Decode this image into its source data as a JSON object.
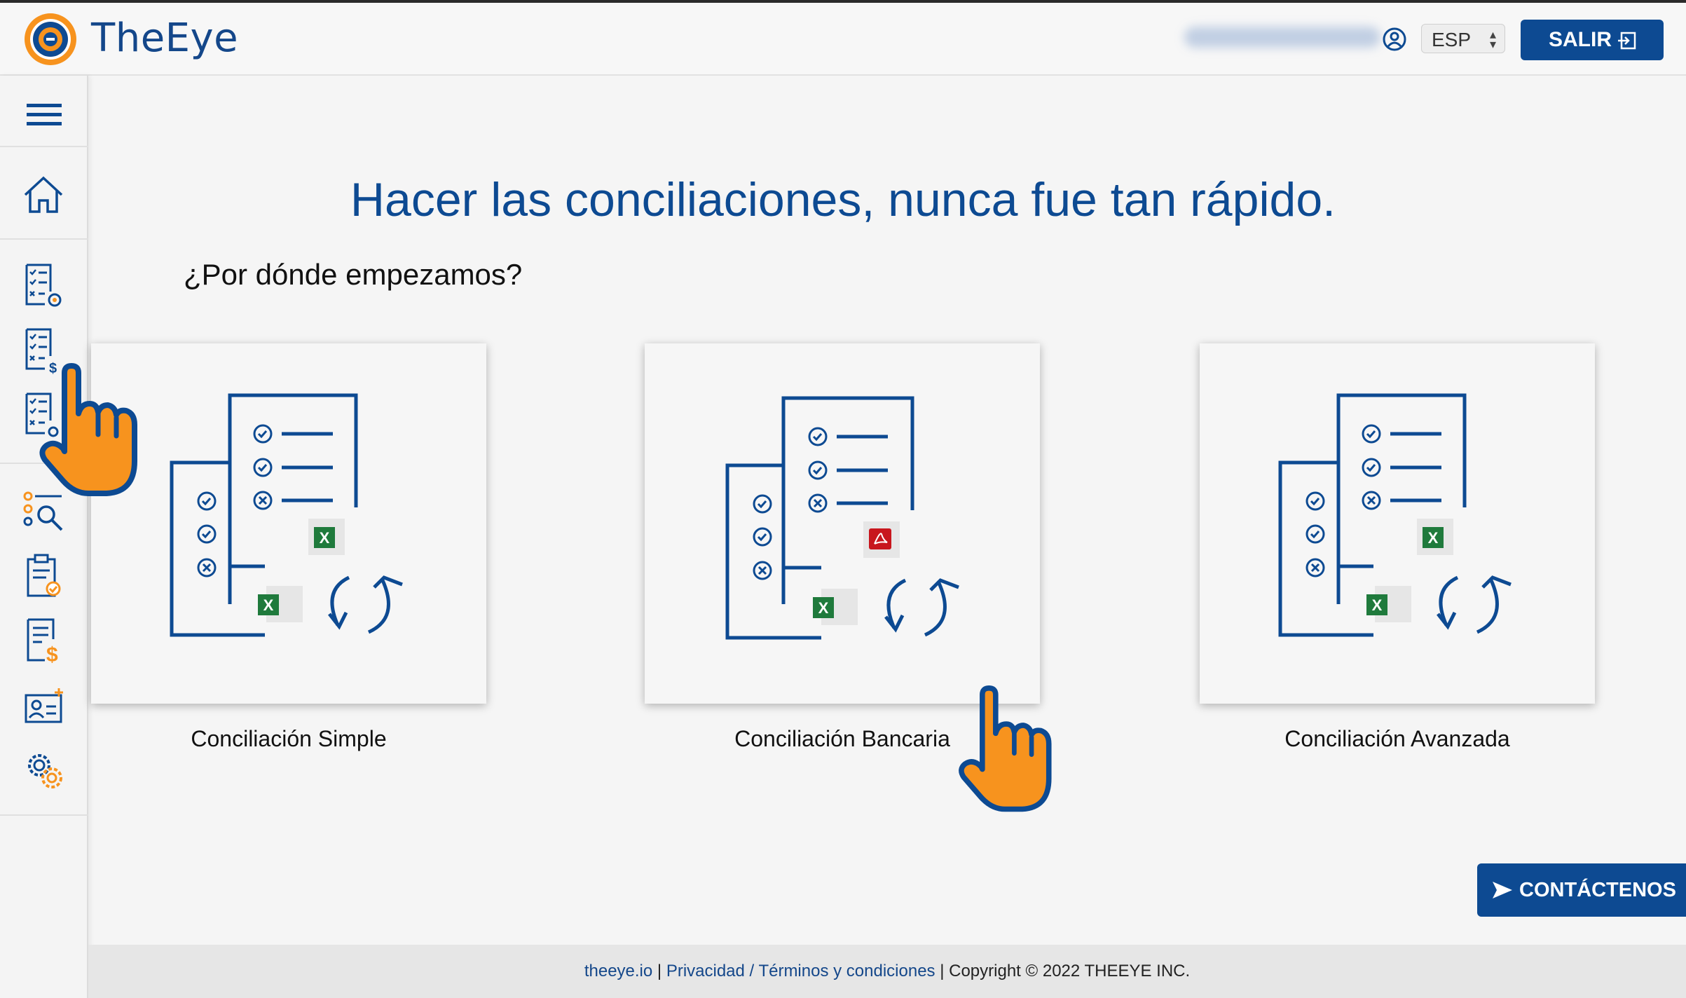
{
  "header": {
    "brand": "TheEye",
    "language": "ESP",
    "logout_label": "SALIR"
  },
  "sidebar": {
    "items": [
      {
        "icon": "menu-icon"
      },
      {
        "icon": "home-icon"
      },
      {
        "icon": "checklist-gear-icon"
      },
      {
        "icon": "checklist-dollar-icon"
      },
      {
        "icon": "checklist-settings-icon"
      },
      {
        "icon": "search-filter-icon"
      },
      {
        "icon": "clipboard-check-icon"
      },
      {
        "icon": "invoice-dollar-icon"
      },
      {
        "icon": "add-user-card-icon"
      },
      {
        "icon": "settings-gears-icon"
      }
    ]
  },
  "main": {
    "headline": "Hacer las conciliaciones, nunca fue tan rápido.",
    "subtitle": "¿Por dónde empezamos?",
    "cards": [
      {
        "label": "Conciliación Simple",
        "badges": [
          "excel",
          "excel"
        ]
      },
      {
        "label": "Conciliación Bancaria",
        "badges": [
          "pdf",
          "excel"
        ]
      },
      {
        "label": "Conciliación Avanzada",
        "badges": [
          "excel",
          "excel"
        ]
      }
    ]
  },
  "contact_button": "CONTÁCTENOS",
  "footer": {
    "site": "theeye.io",
    "sep1": " | ",
    "privacy": "Privacidad / Términos y condiciones",
    "copyright": " | Copyright © 2022 THEEYE INC."
  },
  "colors": {
    "primary": "#0d4a92",
    "accent": "#f7931e",
    "excel": "#1f7a3c",
    "pdf": "#c8161d"
  }
}
